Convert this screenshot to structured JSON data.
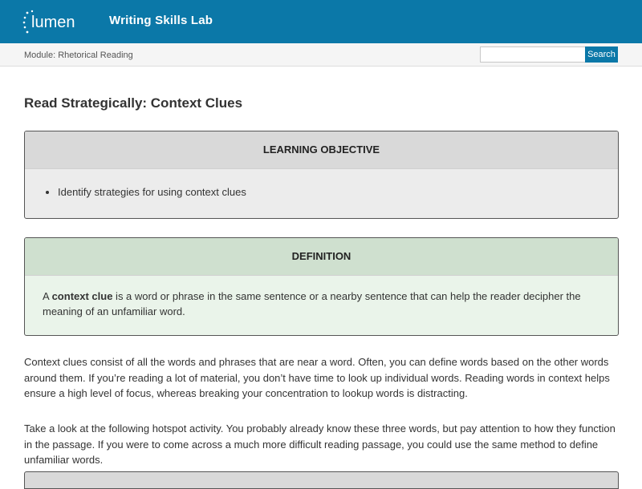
{
  "header": {
    "logo_text": "lumen",
    "site_title": "Writing Skills Lab"
  },
  "subheader": {
    "module_label": "Module: Rhetorical Reading",
    "search_placeholder": "",
    "search_button": "Search"
  },
  "page": {
    "title": "Read Strategically: Context Clues",
    "learning_objective": {
      "heading": "LEARNING OBJECTIVE",
      "items": [
        "Identify strategies for using context clues"
      ]
    },
    "definition": {
      "heading": "DEFINITION",
      "prefix": "A ",
      "term": "context clue",
      "body": " is a word or phrase in the same sentence or a nearby sentence that can help the reader decipher the meaning of an unfamiliar word."
    },
    "paragraphs": [
      "Context clues consist of all the words and phrases that are near a word. Often, you can define words based on the other words around them. If you’re reading a lot of material, you don’t have time to look up individual words. Reading words in context helps ensure a high level of focus, whereas breaking your concentration to lookup words is distracting.",
      "Take a look at the following hotspot activity. You probably already know these three words, but pay attention to how they function in the passage. If you were to come across a much more difficult reading passage, you could use the same method to define unfamiliar words."
    ]
  },
  "colors": {
    "brand": "#0b78a8",
    "objective_header": "#d9d9d9",
    "definition_header": "#cfe0cf",
    "definition_body": "#eaf4ea"
  }
}
